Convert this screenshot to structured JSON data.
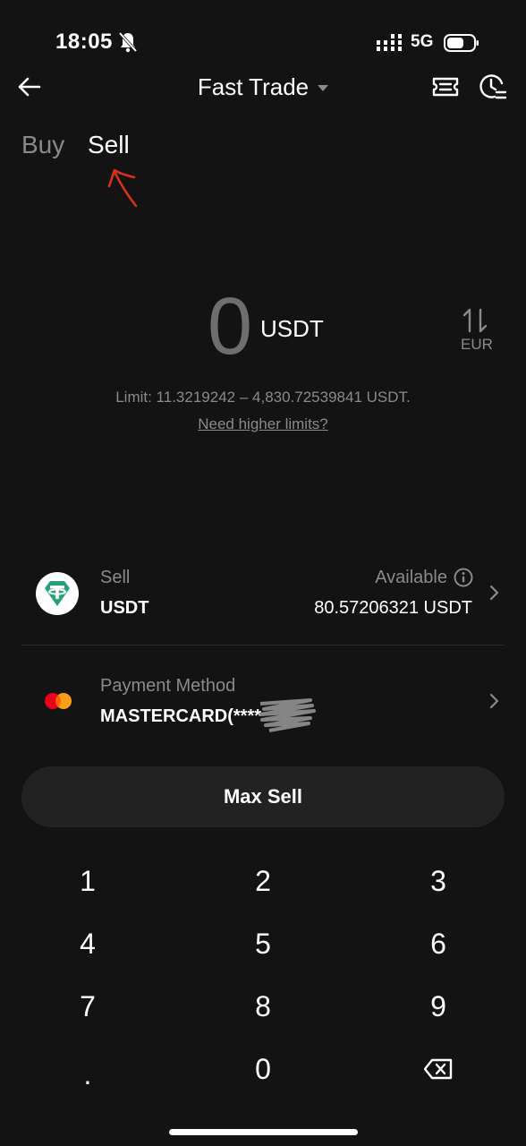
{
  "status_bar": {
    "time": "18:05",
    "network": "5G"
  },
  "header": {
    "title": "Fast Trade"
  },
  "tabs": [
    {
      "label": "Buy",
      "active": false
    },
    {
      "label": "Sell",
      "active": true
    }
  ],
  "amount": {
    "value": "0",
    "unit": "USDT",
    "swap_currency": "EUR",
    "limit_text": "Limit: 11.3219242 – 4,830.72539841 USDT.",
    "higher_limits_link": "Need higher limits?"
  },
  "sell_row": {
    "label": "Sell",
    "asset": "USDT",
    "available_label": "Available",
    "available_value": "80.57206321 USDT"
  },
  "payment_row": {
    "label": "Payment Method",
    "value": "MASTERCARD(****"
  },
  "max_sell_label": "Max Sell",
  "keypad": [
    "1",
    "2",
    "3",
    "4",
    "5",
    "6",
    "7",
    "8",
    "9",
    ".",
    "0",
    "backspace"
  ],
  "colors": {
    "background": "#131313",
    "muted": "#8a8a8a",
    "tether": "#26a17b",
    "annotation": "#d7301f"
  },
  "icons": [
    "back-arrow-icon",
    "caret-down-icon",
    "orders-icon",
    "history-icon",
    "swap-icon",
    "info-icon",
    "chevron-right-icon",
    "tether-icon",
    "mastercard-icon",
    "backspace-icon",
    "bell-muted-icon",
    "signal-icon",
    "battery-icon"
  ]
}
